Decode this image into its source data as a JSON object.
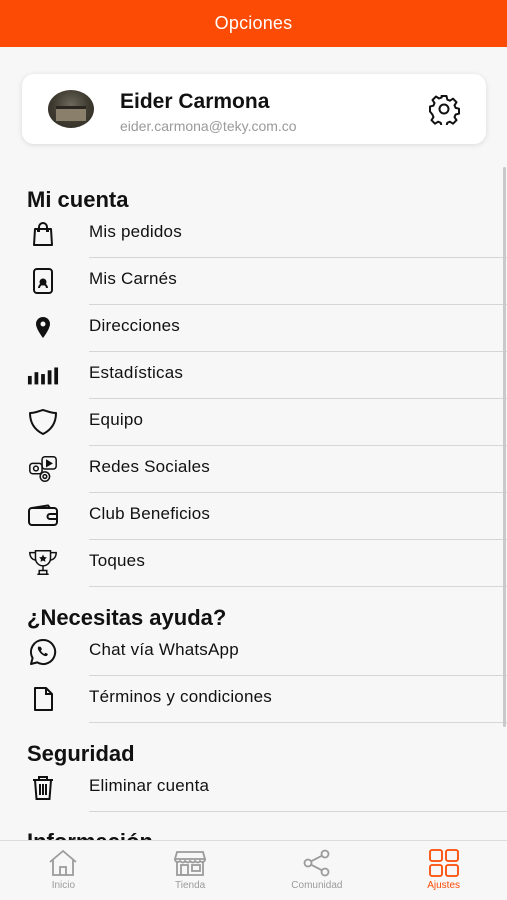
{
  "header": {
    "title": "Opciones"
  },
  "profile": {
    "name": "Eider Carmona",
    "email": "eider.carmona@teky.com.co"
  },
  "sections": {
    "account": {
      "title": "Mi cuenta",
      "items": [
        {
          "label": "Mis pedidos",
          "icon": "shopping-bag-icon"
        },
        {
          "label": "Mis Carnés",
          "icon": "id-card-icon"
        },
        {
          "label": "Direcciones",
          "icon": "location-pin-icon"
        },
        {
          "label": "Estadísticas",
          "icon": "bar-chart-icon"
        },
        {
          "label": "Equipo",
          "icon": "shield-icon"
        },
        {
          "label": "Redes Sociales",
          "icon": "social-networks-icon"
        },
        {
          "label": "Club Beneficios",
          "icon": "wallet-icon"
        },
        {
          "label": "Toques",
          "icon": "trophy-icon"
        }
      ]
    },
    "help": {
      "title": "¿Necesitas ayuda?",
      "items": [
        {
          "label": "Chat vía WhatsApp",
          "icon": "whatsapp-icon"
        },
        {
          "label": "Términos y condiciones",
          "icon": "document-icon"
        }
      ]
    },
    "security": {
      "title": "Seguridad",
      "items": [
        {
          "label": "Eliminar cuenta",
          "icon": "trash-icon"
        }
      ]
    },
    "info": {
      "title": "Información"
    }
  },
  "bottom_nav": {
    "tabs": [
      {
        "label": "Inicio",
        "icon": "home-icon"
      },
      {
        "label": "Tienda",
        "icon": "store-icon"
      },
      {
        "label": "Comunidad",
        "icon": "share-icon"
      },
      {
        "label": "Ajustes",
        "icon": "grid-icon",
        "active": true
      }
    ]
  },
  "colors": {
    "accent": "#fc4b05"
  }
}
